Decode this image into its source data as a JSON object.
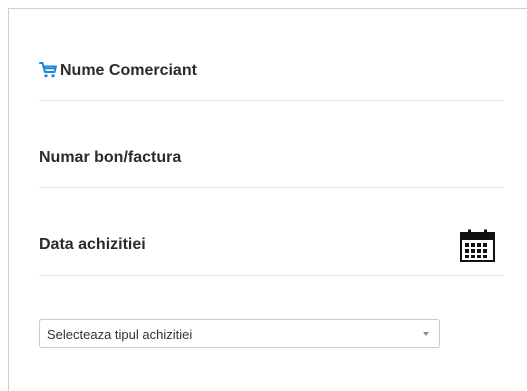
{
  "form": {
    "merchant": {
      "label": "Nume Comerciant",
      "icon": "shopping-cart-icon",
      "icon_color": "#1a8ad6"
    },
    "receipt": {
      "label": "Numar bon/factura"
    },
    "date": {
      "label": "Data achizitiei",
      "icon": "calendar-icon"
    },
    "purchase_type": {
      "selected": "Selecteaza tipul achizitiei"
    }
  },
  "colors": {
    "label_text": "#2b2b2b",
    "divider": "#e6e6e6",
    "accent": "#1a8ad6"
  }
}
